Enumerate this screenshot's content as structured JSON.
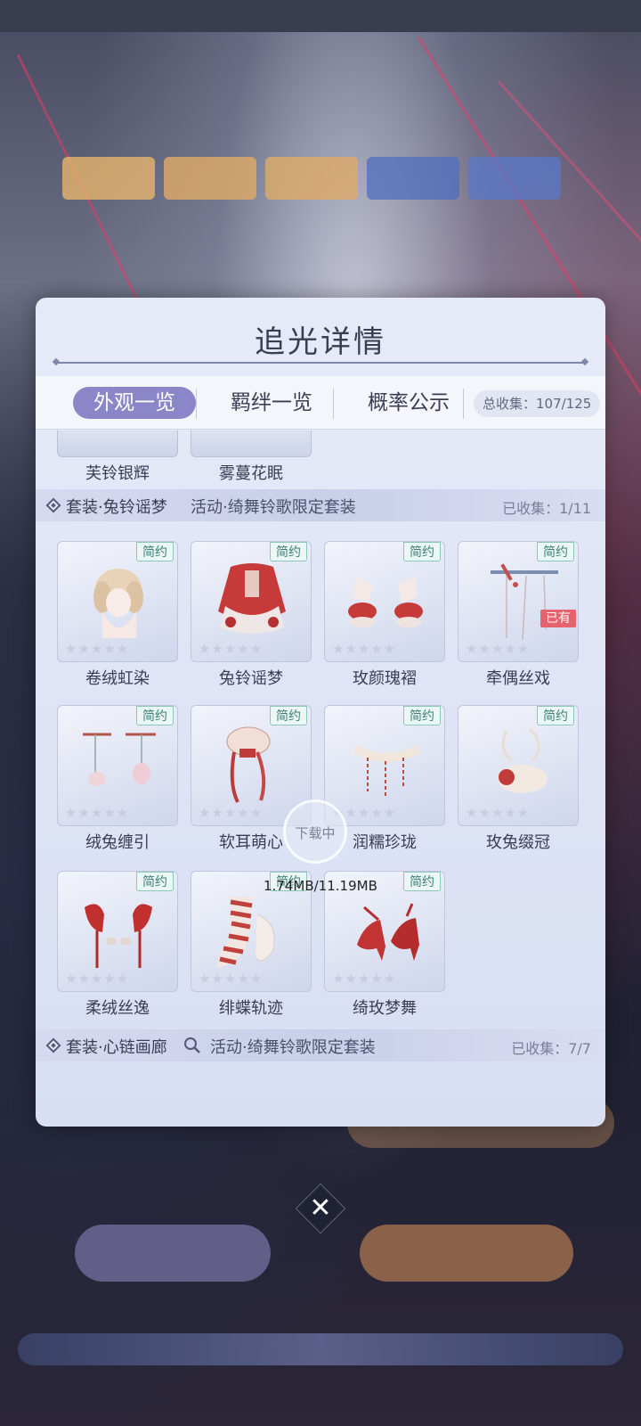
{
  "panel": {
    "title": "追光详情",
    "tabs": [
      {
        "label": "外观一览",
        "active": true
      },
      {
        "label": "羁绊一览",
        "active": false
      },
      {
        "label": "概率公示",
        "active": false
      }
    ],
    "total_label": "总收集：107/125"
  },
  "previous_items": [
    "芙铃银辉",
    "雾蔓花眠"
  ],
  "sections": [
    {
      "name": "套装·兔铃谣梦",
      "source": "活动·绮舞铃歌限定套装",
      "collected": "已收集：1/11",
      "items": [
        {
          "name": "卷绒虹染",
          "badge": "简约",
          "owned": false
        },
        {
          "name": "兔铃谣梦",
          "badge": "简约",
          "owned": false
        },
        {
          "name": "玫颜瑰褶",
          "badge": "简约",
          "owned": false
        },
        {
          "name": "牵偶丝戏",
          "badge": "简约",
          "owned": true,
          "owned_label": "已有"
        },
        {
          "name": "绒兔缠引",
          "badge": "简约",
          "owned": false
        },
        {
          "name": "软耳萌心",
          "badge": "简约",
          "owned": false
        },
        {
          "name": "润糯珍珑",
          "badge": "简约",
          "owned": false
        },
        {
          "name": "玫兔缀冠",
          "badge": "简约",
          "owned": false
        },
        {
          "name": "柔绒丝逸",
          "badge": "简约",
          "owned": false
        },
        {
          "name": "绯蝶轨迹",
          "badge": "简约",
          "owned": false
        },
        {
          "name": "绮玫梦舞",
          "badge": "简约",
          "owned": false
        }
      ]
    },
    {
      "name": "套装·心链画廊",
      "source": "活动·绮舞铃歌限定套装",
      "collected": "已收集：7/7",
      "items": []
    }
  ],
  "download": {
    "label": "下载中",
    "size": "1.74MB/11.19MB"
  },
  "stars_glyph": "★★★★★",
  "close_glyph": "✕",
  "colors": {
    "accent": "#8b86c8",
    "badge": "#3f7f77",
    "owned": "#e6626e",
    "text": "#3b3d55"
  },
  "icons": [
    "diamond-bullet-icon",
    "search-icon",
    "close-icon",
    "star-icon"
  ]
}
